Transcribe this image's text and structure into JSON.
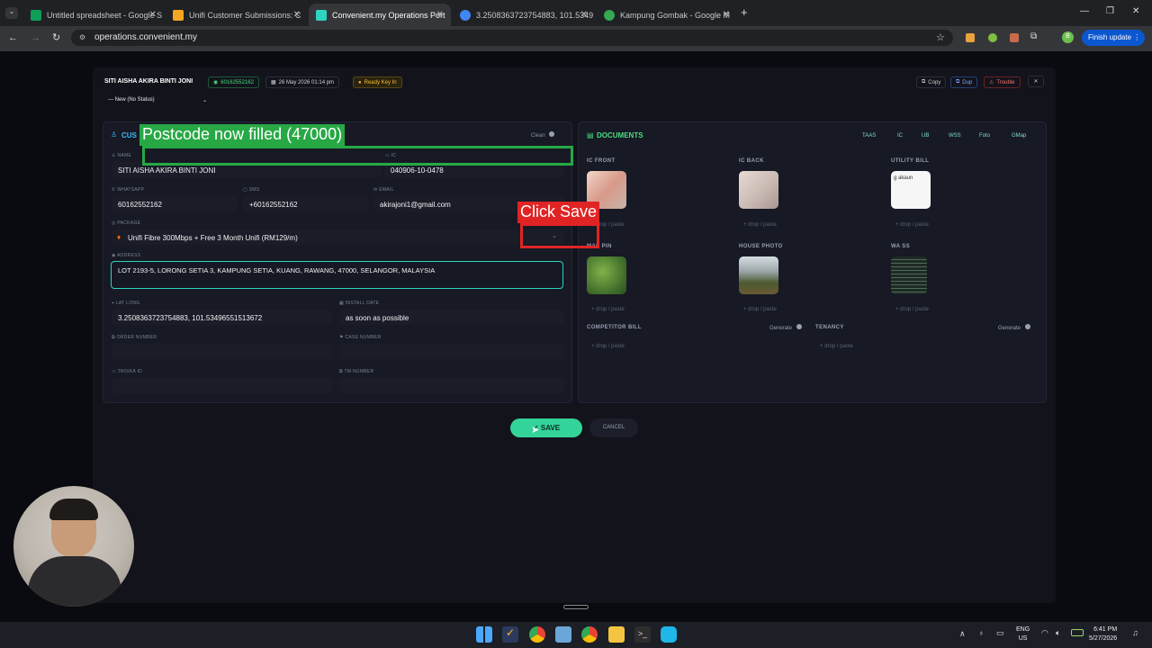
{
  "tabs": [
    {
      "label": "Untitled spreadsheet - Google S",
      "color": "#0f9d58"
    },
    {
      "label": "Unifi Customer Submissions: C",
      "color": "#f6a623"
    },
    {
      "label": "Convenient.my Operations Port",
      "color": "#111"
    },
    {
      "label": "3.2508363723754883, 101.5349",
      "color": "#4285f4"
    },
    {
      "label": "Kampung Gombak - Google M",
      "color": "#34a853"
    }
  ],
  "url": "operations.convenient.my",
  "finish_update": "Finish update",
  "header": {
    "name": "SITI AISHA AKIRA BINTI JONI",
    "phone": "60162552162",
    "date": "26 May 2026 01:14 pm",
    "status_badge": "Ready Key In",
    "status_select": "— New (No Status)",
    "copy": "Copy",
    "dup": "Dup",
    "trouble": "Trouble"
  },
  "customer": {
    "section": "CUS",
    "clean": "Clean",
    "name_label": "NAME",
    "name": "SITI AISHA AKIRA BINTI JONI",
    "ic_label": "IC",
    "ic": "040906-10-0478",
    "whatsapp_label": "WHATSAPP",
    "whatsapp": "60162552162",
    "sms_label": "SMS",
    "sms": "+60162552162",
    "email_label": "EMAIL",
    "email": "akirajoni1@gmail.com",
    "package_label": "PACKAGE",
    "package": "Unifi Fibre 300Mbps + Free 3 Month Unifi (RM129/m)",
    "address_label": "ADDRESS",
    "address": "LOT 2193-5, LORONG SETIA 3, KAMPUNG SETIA, KUANG, RAWANG, 47000, SELANGOR, MALAYSIA",
    "latlong_label": "LAT LONG",
    "latlong": "3.2508363723754883, 101.53496551513672",
    "install_label": "INSTALL DATE",
    "install": "as soon as possible",
    "order_label": "ORDER NUMBER",
    "case_label": "CASE NUMBER",
    "troika_label": "TROIKA ID",
    "tm_label": "TM NUMBER"
  },
  "documents": {
    "title": "DOCUMENTS",
    "chips": [
      "TAAS",
      "IC",
      "UB",
      "WSS",
      "Foto",
      "GMap"
    ],
    "ic_front": "IC FRONT",
    "ic_back": "IC BACK",
    "utility": "UTILITY BILL",
    "map_pin": "MAP PIN",
    "house": "HOUSE PHOTO",
    "wa": "WA SS",
    "competitor": "COMPETITOR BILL",
    "tenancy": "TENANCY",
    "generate": "Generate",
    "drop": "+ drop / paste",
    "utility_text": "g akaun"
  },
  "save": "SAVE",
  "cancel": "CANCEL",
  "annot_postcode": "Postcode now filled (47000)",
  "annot_save": "Click Save",
  "clock": {
    "time": "6:41 PM",
    "date": "5/27/2026",
    "lang1": "ENG",
    "lang2": "US"
  }
}
